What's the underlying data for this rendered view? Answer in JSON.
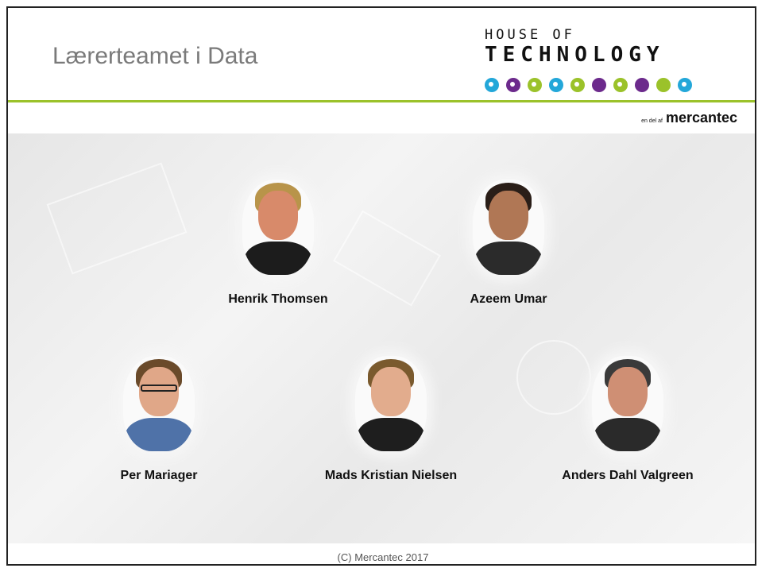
{
  "title": "Lærerteamet i Data",
  "logo": {
    "line1": "HOUSE OF",
    "line2": "TECHNOLOGY",
    "dots": [
      {
        "color": "#23a7d9",
        "inner": true
      },
      {
        "color": "#6c2a8c",
        "inner": true
      },
      {
        "color": "#9bc22a",
        "inner": true
      },
      {
        "color": "#23a7d9",
        "inner": true
      },
      {
        "color": "#9bc22a",
        "inner": true
      },
      {
        "color": "#6c2a8c",
        "inner": false
      },
      {
        "color": "#9bc22a",
        "inner": true
      },
      {
        "color": "#6c2a8c",
        "inner": false
      },
      {
        "color": "#9bc22a",
        "inner": false
      },
      {
        "color": "#23a7d9",
        "inner": true
      }
    ]
  },
  "tagline": "en del af",
  "brand": "mercantec",
  "people": [
    {
      "name": "Henrik Thomsen",
      "hair": "#b8944a",
      "shirt": "#1c1c1c",
      "skin": "#d88a6a",
      "glasses": false
    },
    {
      "name": "Azeem Umar",
      "hair": "#2a1e18",
      "shirt": "#2b2b2b",
      "skin": "#b07755",
      "glasses": false
    },
    {
      "name": "Per Mariager",
      "hair": "#6a4a2a",
      "shirt": "#4f72a8",
      "skin": "#e0a788",
      "glasses": true
    },
    {
      "name": "Mads Kristian Nielsen",
      "hair": "#7a5a2e",
      "shirt": "#1e1e1e",
      "skin": "#e2ac8d",
      "glasses": false
    },
    {
      "name": "Anders Dahl Valgreen",
      "hair": "#3a3a3a",
      "shirt": "#2a2a2a",
      "skin": "#cf8f74",
      "glasses": false
    }
  ],
  "footer": "(C) Mercantec 2017"
}
